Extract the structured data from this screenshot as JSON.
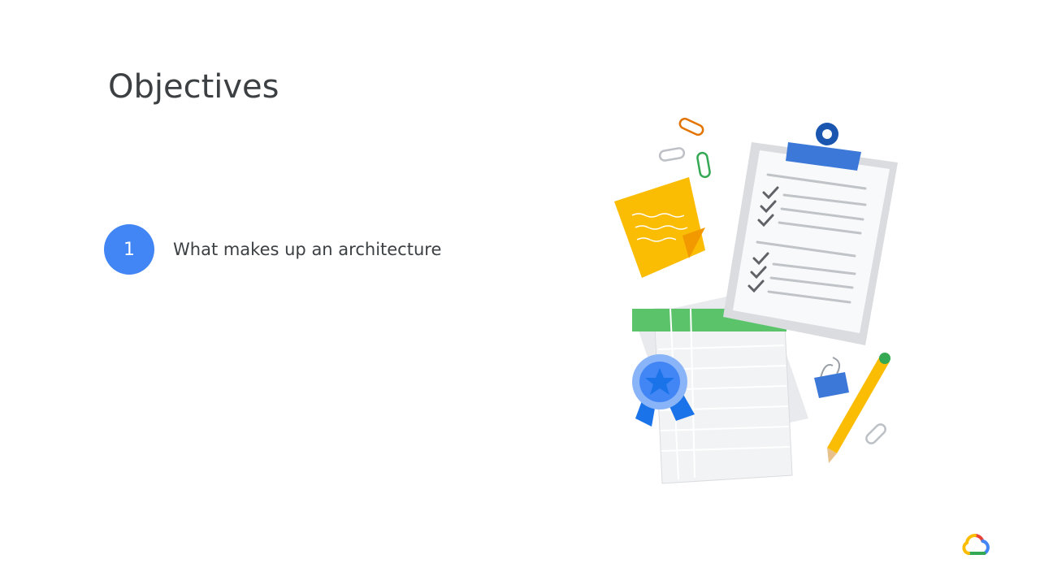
{
  "slide": {
    "title": "Objectives",
    "objectives": [
      {
        "number": "1",
        "text": "What makes up an architecture"
      }
    ]
  },
  "illustration": {
    "description_icons": [
      "clipboard-checklist-icon",
      "sticky-note-icon",
      "spreadsheet-icon",
      "award-ribbon-icon",
      "pencil-icon",
      "binder-clip-icon",
      "paperclip-icon"
    ]
  },
  "logo": {
    "icon": "google-cloud-logo-icon"
  },
  "colors": {
    "accent_blue": "#4285f4",
    "title_text": "#3c4043",
    "green": "#34a853",
    "yellow": "#fbbc04",
    "red": "#ea4335"
  }
}
